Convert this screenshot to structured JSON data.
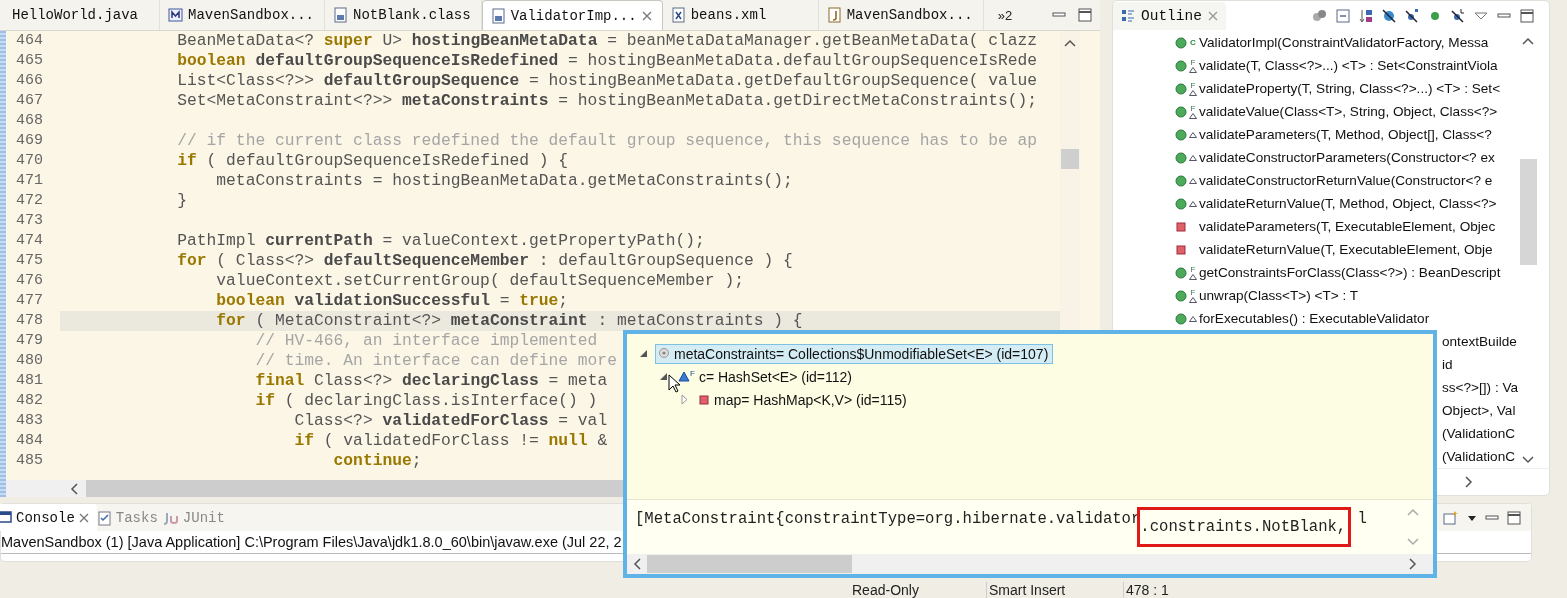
{
  "editor": {
    "tabs": [
      {
        "label": "HelloWorld.java",
        "selected": false
      },
      {
        "label": "MavenSandbox...",
        "selected": false,
        "kind": "maven"
      },
      {
        "label": "NotBlank.class",
        "selected": false,
        "kind": "class"
      },
      {
        "label": "ValidatorImp...",
        "selected": true,
        "kind": "class"
      },
      {
        "label": "beans.xml",
        "selected": false,
        "kind": "xml"
      },
      {
        "label": "MavenSandbox...",
        "selected": false,
        "kind": "java"
      }
    ],
    "overflow": "»2",
    "lines": [
      {
        "number": "464",
        "current": false,
        "tokens": [
          {
            "kind": "plain",
            "text": "            BeanMetaData<? "
          },
          {
            "kind": "keyword",
            "text": "super"
          },
          {
            "kind": "plain",
            "text": " U> "
          },
          {
            "kind": "decl",
            "text": "hostingBeanMetaData"
          },
          {
            "kind": "plain",
            "text": " = beanMetaDataManager.getBeanMetaData( clazz"
          }
        ]
      },
      {
        "number": "465",
        "current": false,
        "tokens": [
          {
            "kind": "keyword",
            "text": "            boolean"
          },
          {
            "kind": "decl",
            "text": " defaultGroupSequenceIsRedefined"
          },
          {
            "kind": "plain",
            "text": " = hostingBeanMetaData.defaultGroupSequenceIsRede"
          }
        ]
      },
      {
        "number": "466",
        "current": false,
        "tokens": [
          {
            "kind": "plain",
            "text": "            List<Class<?>> "
          },
          {
            "kind": "decl",
            "text": "defaultGroupSequence"
          },
          {
            "kind": "plain",
            "text": " = hostingBeanMetaData.getDefaultGroupSequence( value"
          }
        ]
      },
      {
        "number": "467",
        "current": false,
        "tokens": [
          {
            "kind": "plain",
            "text": "            Set<MetaConstraint<?>> "
          },
          {
            "kind": "decl",
            "text": "metaConstraints"
          },
          {
            "kind": "plain",
            "text": " = hostingBeanMetaData.getDirectMetaConstraints();"
          }
        ]
      },
      {
        "number": "468",
        "current": false
      },
      {
        "number": "469",
        "current": false,
        "tokens": [
          {
            "kind": "comment",
            "text": "            // if the current class redefined the default group sequence, this sequence has to be ap"
          }
        ]
      },
      {
        "number": "470",
        "current": false,
        "tokens": [
          {
            "kind": "keyword",
            "text": "            if"
          },
          {
            "kind": "plain",
            "text": " ( defaultGroupSequenceIsRedefined ) {"
          }
        ]
      },
      {
        "number": "471",
        "current": false,
        "tokens": [
          {
            "kind": "plain",
            "text": "                metaConstraints = hostingBeanMetaData.getMetaConstraints();"
          }
        ]
      },
      {
        "number": "472",
        "current": false,
        "tokens": [
          {
            "kind": "plain",
            "text": "            }"
          }
        ]
      },
      {
        "number": "473",
        "current": false
      },
      {
        "number": "474",
        "current": false,
        "tokens": [
          {
            "kind": "plain",
            "text": "            PathImpl "
          },
          {
            "kind": "decl",
            "text": "currentPath"
          },
          {
            "kind": "plain",
            "text": " = valueContext.getPropertyPath();"
          }
        ]
      },
      {
        "number": "475",
        "current": false,
        "tokens": [
          {
            "kind": "keyword",
            "text": "            for"
          },
          {
            "kind": "plain",
            "text": " ( Class<?> "
          },
          {
            "kind": "decl",
            "text": "defaultSequenceMember"
          },
          {
            "kind": "plain",
            "text": " : defaultGroupSequence ) {"
          }
        ]
      },
      {
        "number": "476",
        "current": false,
        "tokens": [
          {
            "kind": "plain",
            "text": "                valueContext.setCurrentGroup( defaultSequenceMember );"
          }
        ]
      },
      {
        "number": "477",
        "current": false,
        "tokens": [
          {
            "kind": "keyword",
            "text": "                boolean"
          },
          {
            "kind": "decl",
            "text": " validationSuccessful"
          },
          {
            "kind": "plain",
            "text": " = "
          },
          {
            "kind": "keyword",
            "text": "true"
          },
          {
            "kind": "plain",
            "text": ";"
          }
        ]
      },
      {
        "number": "478",
        "current": true,
        "tokens": [
          {
            "kind": "keyword",
            "text": "                for"
          },
          {
            "kind": "plain",
            "text": " ( MetaConstraint<?> "
          },
          {
            "kind": "decl",
            "text": "metaConstraint"
          },
          {
            "kind": "plain",
            "text": " : metaConstraints ) {"
          }
        ]
      },
      {
        "number": "479",
        "current": false,
        "tokens": [
          {
            "kind": "comment",
            "text": "                    // HV-466, an interface implemented"
          }
        ]
      },
      {
        "number": "480",
        "current": false,
        "tokens": [
          {
            "kind": "comment",
            "text": "                    // time. An interface can define more"
          }
        ]
      },
      {
        "number": "481",
        "current": false,
        "tokens": [
          {
            "kind": "keyword",
            "text": "                    final"
          },
          {
            "kind": "plain",
            "text": " Class<?> "
          },
          {
            "kind": "decl",
            "text": "declaringClass"
          },
          {
            "kind": "plain",
            "text": " = meta"
          }
        ]
      },
      {
        "number": "482",
        "current": false,
        "tokens": [
          {
            "kind": "keyword",
            "text": "                    if"
          },
          {
            "kind": "plain",
            "text": " ( declaringClass.isInterface() )"
          }
        ]
      },
      {
        "number": "483",
        "current": false,
        "tokens": [
          {
            "kind": "plain",
            "text": "                        Class<?> "
          },
          {
            "kind": "decl",
            "text": "validatedForClass"
          },
          {
            "kind": "plain",
            "text": " = val"
          }
        ]
      },
      {
        "number": "484",
        "current": false,
        "tokens": [
          {
            "kind": "keyword",
            "text": "                        if"
          },
          {
            "kind": "plain",
            "text": " ( validatedForClass != "
          },
          {
            "kind": "keyword",
            "text": "null"
          },
          {
            "kind": "plain",
            "text": " &"
          }
        ]
      },
      {
        "number": "485",
        "current": false,
        "tokens": [
          {
            "kind": "keyword",
            "text": "                            continue"
          },
          {
            "kind": "plain",
            "text": ";"
          }
        ]
      }
    ]
  },
  "outline": {
    "title": "Outline",
    "items": [
      {
        "kind": "public_method",
        "label": "ValidatorImpl(ConstraintValidatorFactory, Messa",
        "badge": "C",
        "overrides": false
      },
      {
        "kind": "public_method",
        "label": "validate(T, Class<?>...) <T> : Set<ConstraintViola",
        "badge": "F",
        "overrides": true
      },
      {
        "kind": "public_method",
        "label": "validateProperty(T, String, Class<?>...) <T> : Set<",
        "badge": "F",
        "overrides": true
      },
      {
        "kind": "public_method",
        "label": "validateValue(Class<T>, String, Object, Class<?>",
        "badge": "F",
        "overrides": true
      },
      {
        "kind": "public_method",
        "label": "validateParameters(T, Method, Object[], Class<?",
        "overrides": true
      },
      {
        "kind": "public_method",
        "label": "validateConstructorParameters(Constructor<? ex",
        "overrides": true
      },
      {
        "kind": "public_method",
        "label": "validateConstructorReturnValue(Constructor<? e",
        "overrides": true
      },
      {
        "kind": "public_method",
        "label": "validateReturnValue(T, Method, Object, Class<?>",
        "overrides": true
      },
      {
        "kind": "private_method",
        "label": "validateParameters(T, ExecutableElement, Objec",
        "overrides": false
      },
      {
        "kind": "private_method",
        "label": "validateReturnValue(T, ExecutableElement, Obje",
        "overrides": false
      },
      {
        "kind": "public_method",
        "label": "getConstraintsForClass(Class<?>) : BeanDescript",
        "badge": "F",
        "overrides": true
      },
      {
        "kind": "public_method",
        "label": "unwrap(Class<T>) <T> : T",
        "badge": "F",
        "overrides": true
      },
      {
        "kind": "public_method",
        "label": "forExecutables() : ExecutableValidator",
        "overrides": true
      },
      {
        "kind": "partial",
        "label": "ontextBuilde"
      },
      {
        "kind": "partial",
        "label": "id"
      },
      {
        "kind": "partial",
        "label": "ss<?>[]) : Va"
      },
      {
        "kind": "partial",
        "label": "Object>, Val"
      },
      {
        "kind": "partial",
        "label": "(ValidationC"
      },
      {
        "kind": "partial",
        "label": "(ValidationC"
      }
    ]
  },
  "console": {
    "tabs": [
      {
        "label": "Console",
        "selected": true,
        "kind": "console"
      },
      {
        "label": "Tasks",
        "selected": false,
        "kind": "tasks"
      },
      {
        "label": "JUnit",
        "selected": false,
        "kind": "junit"
      }
    ],
    "process": "MavenSandbox (1) [Java Application] C:\\Program Files\\Java\\jdk1.8.0_60\\bin\\javaw.exe (Jul 22, 2"
  },
  "status_bar": [
    "Read-Only",
    "Smart Insert",
    "478 : 1"
  ],
  "inspect_popup": {
    "tree": [
      {
        "label": "metaConstraints= Collections$UnmodifiableSet<E>  (id=107)",
        "kind": "local",
        "expanded": true,
        "selected": true,
        "children": [
          {
            "label": "c= HashSet<E>  (id=112)",
            "kind": "field",
            "badge": "F",
            "expanded": true,
            "selected": false,
            "children": [
              {
                "label": "map= HashMap<K,V>  (id=115)",
                "kind": "private_field",
                "expanded": false,
                "selected": false
              }
            ]
          }
        ]
      }
    ],
    "detail": [
      {
        "text": "[MetaConstraint{constraintType=org.hibernate.validator",
        "boxed": false
      },
      {
        "text": ".constraints.NotBlank,",
        "boxed": true
      },
      {
        "text": " l",
        "boxed": false
      }
    ]
  }
}
